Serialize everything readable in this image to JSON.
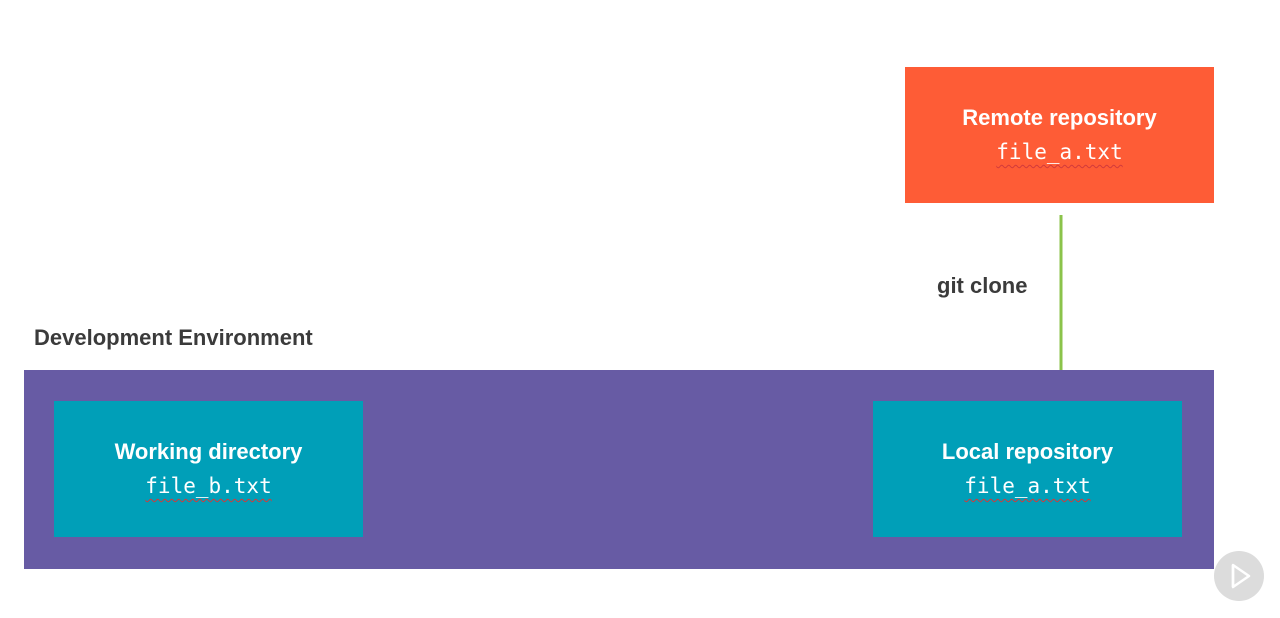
{
  "remote": {
    "title": "Remote repository",
    "file": "file_a.txt"
  },
  "environment": {
    "label": "Development Environment"
  },
  "working": {
    "title": "Working directory",
    "file": "file_b.txt"
  },
  "local": {
    "title": "Local repository",
    "file": "file_a.txt"
  },
  "arrow": {
    "label": "git clone",
    "color": "#8bc34a"
  },
  "colors": {
    "remote": "#fe5c36",
    "environment": "#675ba4",
    "box": "#009fb8"
  },
  "icons": {
    "play": "play-icon"
  }
}
